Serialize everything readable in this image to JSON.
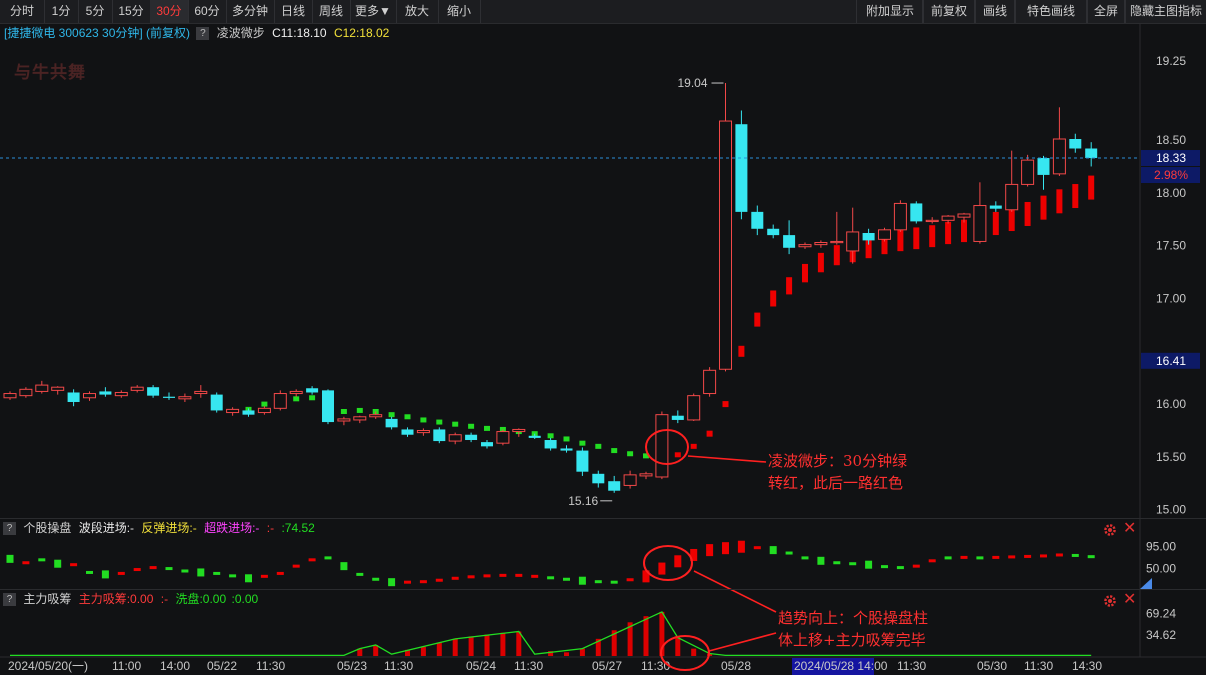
{
  "toolbar": {
    "left": [
      "分时",
      "1分",
      "5分",
      "15分",
      "30分",
      "60分",
      "多分钟",
      "日线",
      "周线",
      "更多▼",
      "放大",
      "缩小"
    ],
    "active": "30分",
    "right": [
      "附加显示",
      "前复权",
      "画线",
      "特色画线",
      "全屏",
      "隐藏主图指标"
    ]
  },
  "info": {
    "stock": "[捷捷微电 300623 30分钟] (前复权)",
    "indicator_name": "凌波微步",
    "c11": "C11:18.10",
    "c12": "C12:18.02"
  },
  "panel2": {
    "name": "个股操盘",
    "l1": "波段进场:-",
    "l2": "反弹进场:-",
    "l3": "超跌进场:-",
    "l4": ":-",
    "l5": ":74.52"
  },
  "panel3": {
    "name": "主力吸筹",
    "l1": "主力吸筹:0.00",
    "l2": ":-",
    "l3": "洗盘:0.00",
    "l4": ":0.00"
  },
  "logo_text": "与牛共舞",
  "annotations": {
    "a1_line1": "凌波微步：30分钟绿",
    "a1_line2": "转红，此后一路红色",
    "a2_line1": "趋势向上：个股操盘柱",
    "a2_line2": "体上移+主力吸筹完毕"
  },
  "colors": {
    "up": "#ff3b3b",
    "down": "#37e6f0",
    "green": "#22dd22",
    "red": "#ee0000",
    "accent": "#ff3b3b"
  },
  "chart_data": {
    "type": "candlestick",
    "price_axis": {
      "ticks": [
        "19.25",
        "18.50",
        "18.00",
        "17.50",
        "17.00",
        "16.00",
        "15.50",
        "15.00"
      ],
      "ylim": [
        14.95,
        19.4
      ]
    },
    "markers": {
      "high": "19.04",
      "low": "15.16"
    },
    "price_labels": {
      "last": "18.33",
      "pct": "2.98%",
      "level": "16.41"
    },
    "time_labels": [
      "2024/05/20(一)",
      "11:00",
      "14:00",
      "05/22",
      "11:30",
      "05/23",
      "11:30",
      "05/24",
      "11:30",
      "05/27",
      "11:30",
      "05/28",
      "2024/05/28 14:00",
      "11:30",
      "05/30",
      "11:30",
      "14:30"
    ],
    "candles": [
      {
        "o": 16.06,
        "h": 16.12,
        "l": 16.04,
        "c": 16.1
      },
      {
        "o": 16.08,
        "h": 16.16,
        "l": 16.06,
        "c": 16.14
      },
      {
        "o": 16.12,
        "h": 16.22,
        "l": 16.1,
        "c": 16.18
      },
      {
        "o": 16.13,
        "h": 16.17,
        "l": 16.09,
        "c": 16.16
      },
      {
        "o": 16.11,
        "h": 16.14,
        "l": 15.98,
        "c": 16.02
      },
      {
        "o": 16.06,
        "h": 16.12,
        "l": 16.03,
        "c": 16.1
      },
      {
        "o": 16.12,
        "h": 16.16,
        "l": 16.07,
        "c": 16.09
      },
      {
        "o": 16.08,
        "h": 16.13,
        "l": 16.06,
        "c": 16.11
      },
      {
        "o": 16.13,
        "h": 16.18,
        "l": 16.11,
        "c": 16.16
      },
      {
        "o": 16.16,
        "h": 16.18,
        "l": 16.06,
        "c": 16.08
      },
      {
        "o": 16.07,
        "h": 16.11,
        "l": 16.04,
        "c": 16.06
      },
      {
        "o": 16.05,
        "h": 16.1,
        "l": 16.02,
        "c": 16.07
      },
      {
        "o": 16.1,
        "h": 16.18,
        "l": 16.06,
        "c": 16.12
      },
      {
        "o": 16.09,
        "h": 16.11,
        "l": 15.92,
        "c": 15.94
      },
      {
        "o": 15.92,
        "h": 15.97,
        "l": 15.89,
        "c": 15.95
      },
      {
        "o": 15.94,
        "h": 15.96,
        "l": 15.88,
        "c": 15.9
      },
      {
        "o": 15.92,
        "h": 15.98,
        "l": 15.9,
        "c": 15.96
      },
      {
        "o": 15.96,
        "h": 16.13,
        "l": 15.94,
        "c": 16.1
      },
      {
        "o": 16.1,
        "h": 16.14,
        "l": 16.07,
        "c": 16.12
      },
      {
        "o": 16.15,
        "h": 16.17,
        "l": 16.09,
        "c": 16.11
      },
      {
        "o": 16.13,
        "h": 16.14,
        "l": 15.81,
        "c": 15.83
      },
      {
        "o": 15.84,
        "h": 15.88,
        "l": 15.8,
        "c": 15.86
      },
      {
        "o": 15.85,
        "h": 15.89,
        "l": 15.82,
        "c": 15.88
      },
      {
        "o": 15.88,
        "h": 15.93,
        "l": 15.86,
        "c": 15.9
      },
      {
        "o": 15.86,
        "h": 15.88,
        "l": 15.76,
        "c": 15.78
      },
      {
        "o": 15.76,
        "h": 15.78,
        "l": 15.69,
        "c": 15.71
      },
      {
        "o": 15.73,
        "h": 15.77,
        "l": 15.7,
        "c": 15.75
      },
      {
        "o": 15.76,
        "h": 15.78,
        "l": 15.63,
        "c": 15.65
      },
      {
        "o": 15.65,
        "h": 15.73,
        "l": 15.62,
        "c": 15.71
      },
      {
        "o": 15.71,
        "h": 15.73,
        "l": 15.64,
        "c": 15.66
      },
      {
        "o": 15.64,
        "h": 15.66,
        "l": 15.58,
        "c": 15.6
      },
      {
        "o": 15.63,
        "h": 15.76,
        "l": 15.61,
        "c": 15.74
      },
      {
        "o": 15.74,
        "h": 15.77,
        "l": 15.69,
        "c": 15.76
      },
      {
        "o": 15.7,
        "h": 15.72,
        "l": 15.67,
        "c": 15.68
      },
      {
        "o": 15.66,
        "h": 15.68,
        "l": 15.56,
        "c": 15.58
      },
      {
        "o": 15.58,
        "h": 15.61,
        "l": 15.54,
        "c": 15.56
      },
      {
        "o": 15.56,
        "h": 15.59,
        "l": 15.32,
        "c": 15.36
      },
      {
        "o": 15.34,
        "h": 15.37,
        "l": 15.21,
        "c": 15.25
      },
      {
        "o": 15.27,
        "h": 15.32,
        "l": 15.16,
        "c": 15.18
      },
      {
        "o": 15.23,
        "h": 15.37,
        "l": 15.2,
        "c": 15.33
      },
      {
        "o": 15.32,
        "h": 15.36,
        "l": 15.29,
        "c": 15.34
      },
      {
        "o": 15.31,
        "h": 15.93,
        "l": 15.29,
        "c": 15.9
      },
      {
        "o": 15.89,
        "h": 15.94,
        "l": 15.82,
        "c": 15.85
      },
      {
        "o": 15.85,
        "h": 16.1,
        "l": 15.84,
        "c": 16.08
      },
      {
        "o": 16.1,
        "h": 16.35,
        "l": 16.07,
        "c": 16.32
      },
      {
        "o": 16.33,
        "h": 19.04,
        "l": 16.31,
        "c": 18.68
      },
      {
        "o": 18.65,
        "h": 18.78,
        "l": 17.75,
        "c": 17.82
      },
      {
        "o": 17.82,
        "h": 17.88,
        "l": 17.6,
        "c": 17.66
      },
      {
        "o": 17.66,
        "h": 17.7,
        "l": 17.57,
        "c": 17.6
      },
      {
        "o": 17.6,
        "h": 17.74,
        "l": 17.42,
        "c": 17.48
      },
      {
        "o": 17.49,
        "h": 17.53,
        "l": 17.47,
        "c": 17.51
      },
      {
        "o": 17.51,
        "h": 17.55,
        "l": 17.48,
        "c": 17.53
      },
      {
        "o": 17.54,
        "h": 17.82,
        "l": 17.51,
        "c": 17.54
      },
      {
        "o": 17.45,
        "h": 17.86,
        "l": 17.33,
        "c": 17.63
      },
      {
        "o": 17.62,
        "h": 17.66,
        "l": 17.51,
        "c": 17.55
      },
      {
        "o": 17.56,
        "h": 17.67,
        "l": 17.54,
        "c": 17.65
      },
      {
        "o": 17.65,
        "h": 17.93,
        "l": 17.63,
        "c": 17.9
      },
      {
        "o": 17.9,
        "h": 17.92,
        "l": 17.71,
        "c": 17.73
      },
      {
        "o": 17.74,
        "h": 17.77,
        "l": 17.71,
        "c": 17.74
      },
      {
        "o": 17.74,
        "h": 17.79,
        "l": 17.71,
        "c": 17.78
      },
      {
        "o": 17.77,
        "h": 17.81,
        "l": 17.72,
        "c": 17.8
      },
      {
        "o": 17.54,
        "h": 18.1,
        "l": 17.52,
        "c": 17.88
      },
      {
        "o": 17.88,
        "h": 17.92,
        "l": 17.82,
        "c": 17.85
      },
      {
        "o": 17.84,
        "h": 18.4,
        "l": 17.82,
        "c": 18.08
      },
      {
        "o": 18.08,
        "h": 18.36,
        "l": 18.06,
        "c": 18.31
      },
      {
        "o": 18.33,
        "h": 18.35,
        "l": 18.03,
        "c": 18.17
      },
      {
        "o": 18.18,
        "h": 18.81,
        "l": 18.16,
        "c": 18.51
      },
      {
        "o": 18.51,
        "h": 18.56,
        "l": 18.38,
        "c": 18.42
      },
      {
        "o": 18.42,
        "h": 18.48,
        "l": 18.25,
        "c": 18.33
      }
    ],
    "lbwb": [
      {
        "i": 15,
        "v": 15.95,
        "c": "g"
      },
      {
        "i": 16,
        "v": 16.0,
        "c": "g"
      },
      {
        "i": 17,
        "v": 16.02,
        "c": "g"
      },
      {
        "i": 18,
        "v": 16.05,
        "c": "g"
      },
      {
        "i": 19,
        "v": 16.06,
        "c": "g"
      },
      {
        "i": 20,
        "v": 16.0,
        "c": "r"
      },
      {
        "i": 21,
        "v": 15.93,
        "c": "g"
      },
      {
        "i": 22,
        "v": 15.94,
        "c": "g"
      },
      {
        "i": 23,
        "v": 15.93,
        "c": "g"
      },
      {
        "i": 24,
        "v": 15.9,
        "c": "g"
      },
      {
        "i": 25,
        "v": 15.88,
        "c": "g"
      },
      {
        "i": 26,
        "v": 15.85,
        "c": "g"
      },
      {
        "i": 27,
        "v": 15.83,
        "c": "g"
      },
      {
        "i": 28,
        "v": 15.81,
        "c": "g"
      },
      {
        "i": 29,
        "v": 15.79,
        "c": "g"
      },
      {
        "i": 30,
        "v": 15.77,
        "c": "g"
      },
      {
        "i": 31,
        "v": 15.76,
        "c": "g"
      },
      {
        "i": 32,
        "v": 15.74,
        "c": "g"
      },
      {
        "i": 33,
        "v": 15.72,
        "c": "g"
      },
      {
        "i": 34,
        "v": 15.7,
        "c": "g"
      },
      {
        "i": 35,
        "v": 15.67,
        "c": "g"
      },
      {
        "i": 36,
        "v": 15.63,
        "c": "g"
      },
      {
        "i": 37,
        "v": 15.6,
        "c": "g"
      },
      {
        "i": 38,
        "v": 15.56,
        "c": "g"
      },
      {
        "i": 39,
        "v": 15.53,
        "c": "g"
      },
      {
        "i": 40,
        "v": 15.51,
        "c": "g"
      },
      {
        "i": 41,
        "v": 15.5,
        "c": "r"
      },
      {
        "i": 42,
        "v": 15.52,
        "c": "r"
      },
      {
        "i": 43,
        "v": 15.6,
        "c": "r"
      },
      {
        "i": 44,
        "v": 15.72,
        "c": "r"
      },
      {
        "i": 45,
        "v": 16.0,
        "c": "r"
      },
      {
        "i": 46,
        "v": 16.5,
        "c": "r"
      },
      {
        "i": 47,
        "v": 16.8,
        "c": "r"
      },
      {
        "i": 48,
        "v": 17.0,
        "c": "r"
      },
      {
        "i": 49,
        "v": 17.12,
        "c": "r"
      },
      {
        "i": 50,
        "v": 17.24,
        "c": "r"
      },
      {
        "i": 51,
        "v": 17.34,
        "c": "r"
      },
      {
        "i": 52,
        "v": 17.41,
        "c": "r"
      },
      {
        "i": 53,
        "v": 17.44,
        "c": "r"
      },
      {
        "i": 54,
        "v": 17.48,
        "c": "r"
      },
      {
        "i": 55,
        "v": 17.52,
        "c": "r"
      },
      {
        "i": 56,
        "v": 17.55,
        "c": "r"
      },
      {
        "i": 57,
        "v": 17.57,
        "c": "r"
      },
      {
        "i": 58,
        "v": 17.59,
        "c": "r"
      },
      {
        "i": 59,
        "v": 17.62,
        "c": "r"
      },
      {
        "i": 60,
        "v": 17.64,
        "c": "r"
      },
      {
        "i": 61,
        "v": 17.67,
        "c": "r"
      },
      {
        "i": 62,
        "v": 17.71,
        "c": "r"
      },
      {
        "i": 63,
        "v": 17.75,
        "c": "r"
      },
      {
        "i": 64,
        "v": 17.8,
        "c": "r"
      },
      {
        "i": 65,
        "v": 17.86,
        "c": "r"
      },
      {
        "i": 66,
        "v": 17.92,
        "c": "r"
      },
      {
        "i": 67,
        "v": 17.97,
        "c": "r"
      },
      {
        "i": 68,
        "v": 18.05,
        "c": "r"
      }
    ],
    "panel2_axis": {
      "ticks": [
        "95.00",
        "50.00"
      ],
      "ylim": [
        10,
        115
      ]
    },
    "panel2_bars": [
      {
        "i": 0,
        "v": 70,
        "c": "g"
      },
      {
        "i": 1,
        "v": 62,
        "c": "r"
      },
      {
        "i": 2,
        "v": 68,
        "c": "g"
      },
      {
        "i": 3,
        "v": 60,
        "c": "g"
      },
      {
        "i": 4,
        "v": 58,
        "c": "r"
      },
      {
        "i": 5,
        "v": 42,
        "c": "g"
      },
      {
        "i": 6,
        "v": 38,
        "c": "g"
      },
      {
        "i": 7,
        "v": 40,
        "c": "r"
      },
      {
        "i": 8,
        "v": 48,
        "c": "r"
      },
      {
        "i": 9,
        "v": 52,
        "c": "r"
      },
      {
        "i": 10,
        "v": 50,
        "c": "g"
      },
      {
        "i": 11,
        "v": 45,
        "c": "g"
      },
      {
        "i": 12,
        "v": 42,
        "c": "g"
      },
      {
        "i": 13,
        "v": 40,
        "c": "g"
      },
      {
        "i": 14,
        "v": 35,
        "c": "g"
      },
      {
        "i": 15,
        "v": 30,
        "c": "g"
      },
      {
        "i": 16,
        "v": 34,
        "c": "r"
      },
      {
        "i": 17,
        "v": 40,
        "c": "r"
      },
      {
        "i": 18,
        "v": 55,
        "c": "r"
      },
      {
        "i": 19,
        "v": 68,
        "c": "r"
      },
      {
        "i": 20,
        "v": 72,
        "c": "g"
      },
      {
        "i": 21,
        "v": 55,
        "c": "g"
      },
      {
        "i": 22,
        "v": 38,
        "c": "g"
      },
      {
        "i": 23,
        "v": 28,
        "c": "g"
      },
      {
        "i": 24,
        "v": 22,
        "c": "g"
      },
      {
        "i": 25,
        "v": 22,
        "c": "r"
      },
      {
        "i": 26,
        "v": 23,
        "c": "r"
      },
      {
        "i": 27,
        "v": 26,
        "c": "r"
      },
      {
        "i": 28,
        "v": 30,
        "c": "r"
      },
      {
        "i": 29,
        "v": 33,
        "c": "r"
      },
      {
        "i": 30,
        "v": 35,
        "c": "r"
      },
      {
        "i": 31,
        "v": 36,
        "c": "r"
      },
      {
        "i": 32,
        "v": 36,
        "c": "r"
      },
      {
        "i": 33,
        "v": 34,
        "c": "r"
      },
      {
        "i": 34,
        "v": 31,
        "c": "g"
      },
      {
        "i": 35,
        "v": 28,
        "c": "g"
      },
      {
        "i": 36,
        "v": 25,
        "c": "g"
      },
      {
        "i": 37,
        "v": 23,
        "c": "g"
      },
      {
        "i": 38,
        "v": 22,
        "c": "g"
      },
      {
        "i": 39,
        "v": 27,
        "c": "r"
      },
      {
        "i": 40,
        "v": 34,
        "c": "r"
      },
      {
        "i": 41,
        "v": 50,
        "c": "r"
      },
      {
        "i": 42,
        "v": 65,
        "c": "r"
      },
      {
        "i": 43,
        "v": 78,
        "c": "r"
      },
      {
        "i": 44,
        "v": 88,
        "c": "r"
      },
      {
        "i": 45,
        "v": 92,
        "c": "r"
      },
      {
        "i": 46,
        "v": 95,
        "c": "r"
      },
      {
        "i": 47,
        "v": 93,
        "c": "r"
      },
      {
        "i": 48,
        "v": 88,
        "c": "g"
      },
      {
        "i": 49,
        "v": 82,
        "c": "g"
      },
      {
        "i": 50,
        "v": 72,
        "c": "g"
      },
      {
        "i": 51,
        "v": 66,
        "c": "g"
      },
      {
        "i": 52,
        "v": 62,
        "c": "g"
      },
      {
        "i": 53,
        "v": 60,
        "c": "g"
      },
      {
        "i": 54,
        "v": 58,
        "c": "g"
      },
      {
        "i": 55,
        "v": 54,
        "c": "g"
      },
      {
        "i": 56,
        "v": 52,
        "c": "g"
      },
      {
        "i": 57,
        "v": 55,
        "c": "r"
      },
      {
        "i": 58,
        "v": 66,
        "c": "r"
      },
      {
        "i": 59,
        "v": 72,
        "c": "g"
      },
      {
        "i": 60,
        "v": 73,
        "c": "r"
      },
      {
        "i": 61,
        "v": 72,
        "c": "g"
      },
      {
        "i": 62,
        "v": 73,
        "c": "r"
      },
      {
        "i": 63,
        "v": 74,
        "c": "r"
      },
      {
        "i": 64,
        "v": 75,
        "c": "r"
      },
      {
        "i": 65,
        "v": 76,
        "c": "r"
      },
      {
        "i": 66,
        "v": 78,
        "c": "r"
      },
      {
        "i": 67,
        "v": 77,
        "c": "g"
      },
      {
        "i": 68,
        "v": 74.52,
        "c": "g"
      }
    ],
    "panel3_axis": {
      "ticks": [
        "69.24",
        "34.62"
      ],
      "ylim": [
        0,
        80
      ]
    },
    "panel3_bars": [
      {
        "i": 22,
        "v": 12
      },
      {
        "i": 23,
        "v": 18
      },
      {
        "i": 25,
        "v": 10
      },
      {
        "i": 26,
        "v": 15
      },
      {
        "i": 27,
        "v": 22
      },
      {
        "i": 28,
        "v": 28
      },
      {
        "i": 29,
        "v": 32
      },
      {
        "i": 30,
        "v": 35
      },
      {
        "i": 31,
        "v": 38
      },
      {
        "i": 32,
        "v": 40
      },
      {
        "i": 34,
        "v": 8
      },
      {
        "i": 35,
        "v": 6
      },
      {
        "i": 36,
        "v": 12
      },
      {
        "i": 37,
        "v": 28
      },
      {
        "i": 38,
        "v": 42
      },
      {
        "i": 39,
        "v": 55
      },
      {
        "i": 40,
        "v": 65
      },
      {
        "i": 41,
        "v": 72
      },
      {
        "i": 42,
        "v": 30
      },
      {
        "i": 43,
        "v": 12
      },
      {
        "i": 44,
        "v": 4
      }
    ],
    "panel3_line": [
      {
        "i": 0,
        "v": 1
      },
      {
        "i": 21,
        "v": 1
      },
      {
        "i": 22,
        "v": 12
      },
      {
        "i": 23,
        "v": 18
      },
      {
        "i": 24,
        "v": 3
      },
      {
        "i": 28,
        "v": 28
      },
      {
        "i": 32,
        "v": 40
      },
      {
        "i": 33,
        "v": 3
      },
      {
        "i": 36,
        "v": 12
      },
      {
        "i": 41,
        "v": 72
      },
      {
        "i": 42,
        "v": 30
      },
      {
        "i": 44,
        "v": 4
      },
      {
        "i": 45,
        "v": 1
      },
      {
        "i": 68,
        "v": 1
      }
    ]
  }
}
